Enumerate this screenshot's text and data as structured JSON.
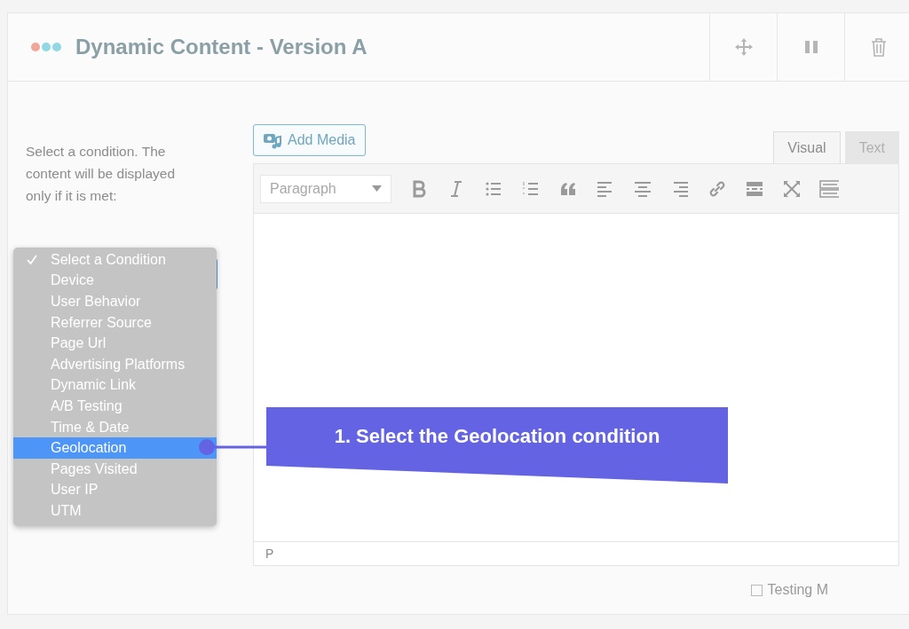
{
  "header": {
    "title": "Dynamic Content - Version A",
    "actions": [
      {
        "kind": "move"
      },
      {
        "kind": "pause"
      },
      {
        "kind": "trash"
      }
    ]
  },
  "condition_help": "Select a condition. The content will be displayed only if it is met:",
  "condition_menu": [
    {
      "label": "Select a Condition",
      "checked": true,
      "selected": false
    },
    {
      "label": "Device",
      "checked": false,
      "selected": false
    },
    {
      "label": "User Behavior",
      "checked": false,
      "selected": false
    },
    {
      "label": "Referrer Source",
      "checked": false,
      "selected": false
    },
    {
      "label": "Page Url",
      "checked": false,
      "selected": false
    },
    {
      "label": "Advertising Platforms",
      "checked": false,
      "selected": false
    },
    {
      "label": "Dynamic Link",
      "checked": false,
      "selected": false
    },
    {
      "label": "A/B Testing",
      "checked": false,
      "selected": false
    },
    {
      "label": "Time & Date",
      "checked": false,
      "selected": false
    },
    {
      "label": "Geolocation",
      "checked": false,
      "selected": true
    },
    {
      "label": "Pages Visited",
      "checked": false,
      "selected": false
    },
    {
      "label": "User IP",
      "checked": false,
      "selected": false
    },
    {
      "label": "UTM",
      "checked": false,
      "selected": false
    }
  ],
  "callout": "1. Select the Geolocation condition",
  "editor": {
    "add_media": "Add Media",
    "tabs": [
      {
        "label": "Visual",
        "selected": true
      },
      {
        "label": "Text",
        "selected": false
      }
    ],
    "format": "Paragraph",
    "tools": [
      {
        "kind": "bold"
      },
      {
        "kind": "italic"
      },
      {
        "kind": "bullets"
      },
      {
        "kind": "numbers"
      },
      {
        "kind": "quote"
      },
      {
        "kind": "align-left"
      },
      {
        "kind": "align-center"
      },
      {
        "kind": "align-right"
      },
      {
        "kind": "link"
      },
      {
        "kind": "more"
      },
      {
        "kind": "fullscreen"
      },
      {
        "kind": "toolbar"
      }
    ],
    "path": "P"
  },
  "testing_mode": {
    "label": "Testing M",
    "checked": false
  }
}
